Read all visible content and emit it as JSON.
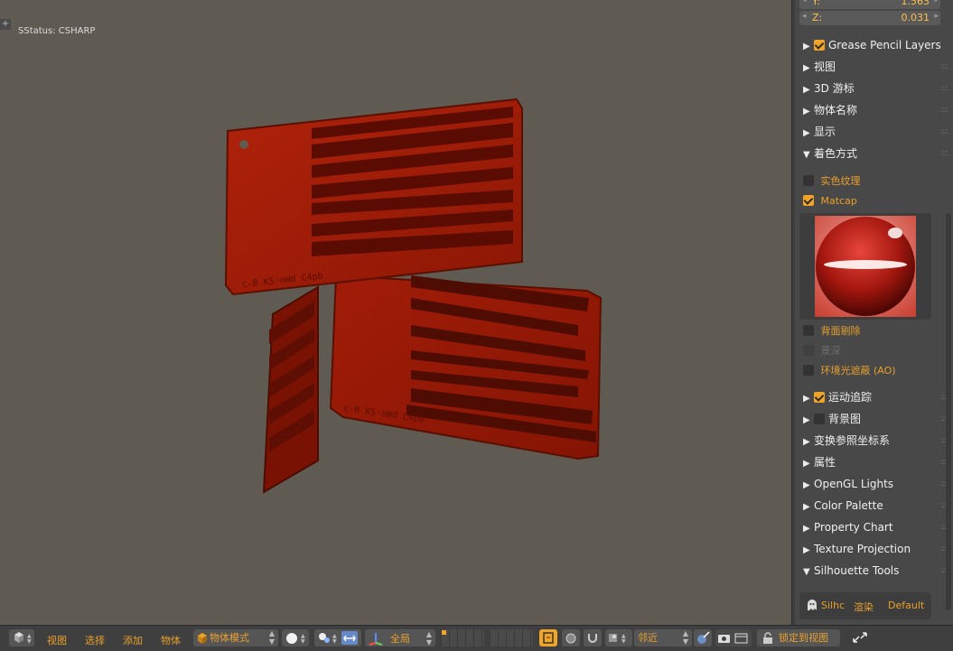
{
  "viewport": {
    "status_text": "SStatus: CSHARP",
    "corner_button": "+"
  },
  "panel": {
    "coords": {
      "y_label": "Y:",
      "y_value": "1.563",
      "z_label": "Z:",
      "z_value": "0.031"
    },
    "sections": [
      {
        "label": "Grease Pencil Layers",
        "checkbox": true,
        "open": false
      },
      {
        "label": "视图",
        "open": false
      },
      {
        "label": "3D 游标",
        "open": false
      },
      {
        "label": "物体名称",
        "open": false
      },
      {
        "label": "显示",
        "open": false
      },
      {
        "label": "着色方式",
        "open": true
      }
    ],
    "shading": {
      "solid_texture": "实色纹理",
      "matcap": "Matcap",
      "backface_culling": "背面剔除",
      "depth_of_field": "景深",
      "ambient_occlusion": "环境光遮蔽 (AO)"
    },
    "sections_after": [
      {
        "label": "运动追踪",
        "checkbox": true
      },
      {
        "label": "背景图",
        "checkbox": false
      },
      {
        "label": "变换参照坐标系"
      },
      {
        "label": "属性"
      },
      {
        "label": "OpenGL Lights"
      },
      {
        "label": "Color Palette"
      },
      {
        "label": "Property Chart"
      },
      {
        "label": "Texture Projection"
      },
      {
        "label": "Silhouette Tools",
        "open": true
      }
    ],
    "silhouette": {
      "tab1": "Silhc",
      "tab2": "渲染",
      "tab3": "Default"
    }
  },
  "header": {
    "menu": [
      "视图",
      "选择",
      "添加",
      "物体"
    ],
    "mode": "物体模式",
    "orientation": "全局",
    "snap": "邻近",
    "lock_to_view": "锁定到视图"
  },
  "colors": {
    "viewport_bg": "#5f5b52",
    "accent": "#e8a02c",
    "model": "#9a1a06"
  }
}
